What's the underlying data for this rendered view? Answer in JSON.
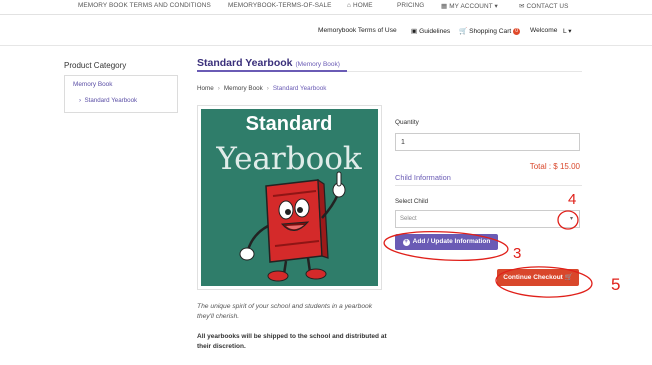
{
  "top_nav": {
    "items": [
      "MEMORY BOOK TERMS AND CONDITIONS",
      "MEMORYBOOK-TERMS-OF-SALE",
      "HOME",
      "PRICING",
      "MY ACCOUNT",
      "CONTACT US"
    ]
  },
  "sub_nav": {
    "terms": "Memorybook Terms of Use",
    "guidelines": "Guidelines",
    "cart": "Shopping Cart",
    "cart_count": "0",
    "welcome": "Welcome",
    "user": "L"
  },
  "sidebar": {
    "title": "Product Category",
    "category": "Memory Book",
    "subcategory": "Standard Yearbook"
  },
  "product": {
    "title": "Standard Yearbook",
    "subtitle": "(Memory Book)",
    "breadcrumb": [
      "Home",
      "Memory Book",
      "Standard Yearbook"
    ],
    "image": {
      "line1": "Standard",
      "line2": "Yearbook"
    },
    "description": "The unique spirit of your school and students in a yearbook they'll cherish.",
    "shipping_note": "All yearbooks will be shipped to the school and distributed at their discretion."
  },
  "order": {
    "quantity_label": "Quantity",
    "quantity_value": "1",
    "total": "Total : $ 15.00",
    "child_info_heading": "Child Information",
    "select_child_label": "Select Child",
    "select_child_value": "Select",
    "add_button": "Add / Update Information",
    "checkout_button": "Continue Checkout"
  },
  "annotations": [
    "4",
    "3",
    "5"
  ],
  "colors": {
    "accent": "#6a5bb5",
    "checkout": "#d9472b",
    "annotation": "#e0201a",
    "chalkboard": "#2f7d6a"
  }
}
